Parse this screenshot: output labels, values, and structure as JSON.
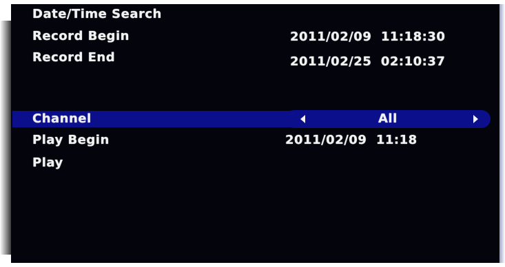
{
  "menu": {
    "title": "Date/Time Search",
    "record_begin": {
      "label": "Record Begin",
      "value": "2011/02/09  11:18:30"
    },
    "record_end": {
      "label": "Record End",
      "value": "2011/02/25  02:10:37"
    },
    "channel": {
      "label": "Channel",
      "value": "All",
      "left_icon": "arrow-left-icon",
      "right_icon": "arrow-right-icon"
    },
    "play_begin": {
      "label": "Play Begin",
      "value": "2011/02/09  11:18"
    },
    "play": {
      "label": "Play"
    }
  },
  "colors": {
    "background": "#04040c",
    "highlight": "#0b0f8c",
    "text": "#f2f2f2"
  }
}
